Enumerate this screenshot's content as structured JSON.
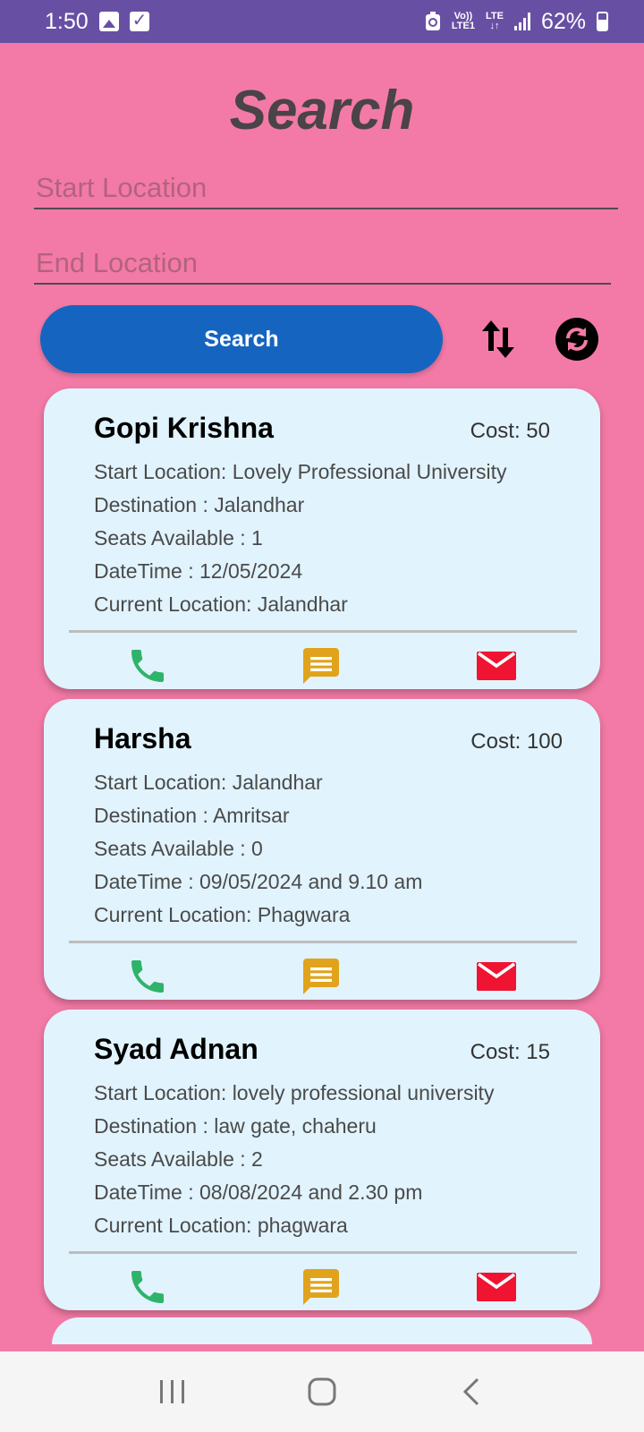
{
  "status_bar": {
    "time": "1:50",
    "network_top": "Vo))",
    "network_bottom": "LTE1",
    "lte_label": "LTE",
    "battery": "62%"
  },
  "page": {
    "title": "Search"
  },
  "search": {
    "start_placeholder": "Start Location",
    "end_placeholder": "End Location",
    "button_label": "Search"
  },
  "colors": {
    "background": "#f37aa6",
    "status_bar": "#6750a4",
    "search_button": "#1565c0",
    "card": "#e1f3fd",
    "call": "#2fb36a",
    "message": "#e0a31b",
    "mail": "#ef1431"
  },
  "icons": {
    "swap": "swap-vertical-icon",
    "refresh": "refresh-circle-icon",
    "call": "phone-icon",
    "message": "message-icon",
    "mail": "mail-icon"
  },
  "rides": [
    {
      "name": "Gopi Krishna",
      "cost": "Cost: 50",
      "start": "Start Location: Lovely Professional University",
      "destination": "Destination : Jalandhar",
      "seats": "Seats Available : 1",
      "datetime": "DateTime : 12/05/2024",
      "current": "Current Location: Jalandhar"
    },
    {
      "name": "Harsha",
      "cost": "Cost: 100",
      "start": "Start Location: Jalandhar",
      "destination": "Destination : Amritsar",
      "seats": "Seats Available : 0",
      "datetime": "DateTime : 09/05/2024 and 9.10 am",
      "current": "Current Location: Phagwara"
    },
    {
      "name": "Syad Adnan",
      "cost": "Cost: 15",
      "start": "Start Location: lovely professional university",
      "destination": "Destination : law gate, chaheru",
      "seats": "Seats Available : 2",
      "datetime": "DateTime : 08/08/2024 and 2.30 pm",
      "current": "Current Location: phagwara"
    }
  ]
}
